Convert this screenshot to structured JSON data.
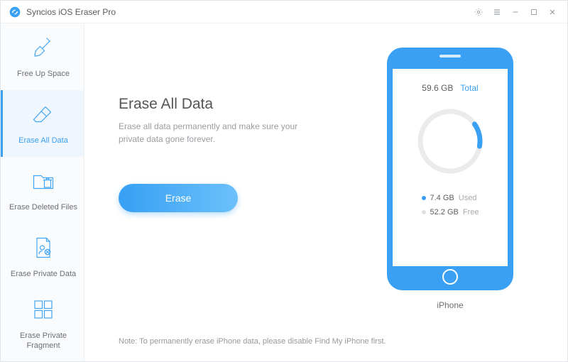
{
  "app": {
    "title": "Syncios iOS Eraser Pro"
  },
  "sidebar": {
    "items": [
      {
        "label": "Free Up Space"
      },
      {
        "label": "Erase All Data"
      },
      {
        "label": "Erase Deleted Files"
      },
      {
        "label": "Erase Private Data"
      },
      {
        "label": "Erase Private Fragment"
      }
    ],
    "active_index": 1
  },
  "main": {
    "title": "Erase All Data",
    "subtitle": "Erase all data permanently and make sure your private data gone forever.",
    "button_label": "Erase",
    "note": "Note: To permanently erase iPhone data, please disable Find My iPhone first."
  },
  "device": {
    "total_value": "59.6 GB",
    "total_label": "Total",
    "used_value": "7.4 GB",
    "used_label": "Used",
    "free_value": "52.2 GB",
    "free_label": "Free",
    "used_fraction": 0.124,
    "name": "iPhone"
  },
  "colors": {
    "accent": "#3aa0f3"
  }
}
